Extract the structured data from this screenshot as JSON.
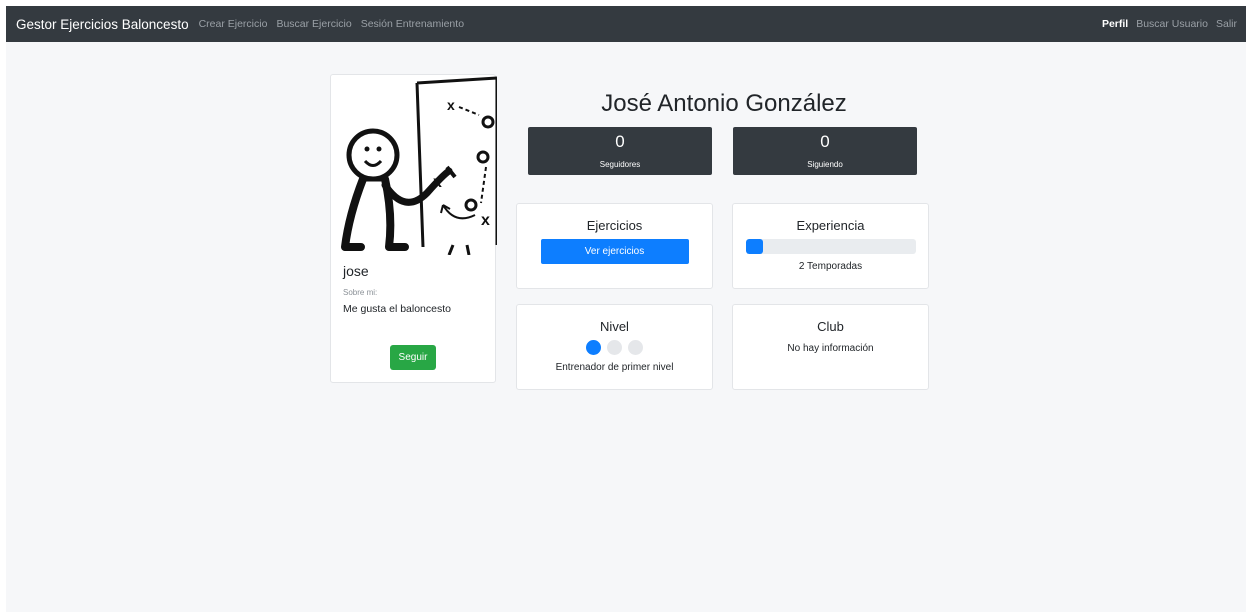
{
  "navbar": {
    "brand": "Gestor Ejercicios Baloncesto",
    "links": [
      "Crear Ejercicio",
      "Buscar Ejercicio",
      "Sesión Entrenamiento"
    ],
    "right_links": [
      "Perfil",
      "Buscar Usuario",
      "Salir"
    ],
    "active_link": "Perfil"
  },
  "profile": {
    "username": "jose",
    "about_label": "Sobre mi:",
    "about_text": "Me gusta el baloncesto",
    "follow_label": "Seguir",
    "full_name": "José Antonio González"
  },
  "stats": {
    "followers_count": "0",
    "followers_label": "Seguidores",
    "following_count": "0",
    "following_label": "Siguiendo"
  },
  "exercises": {
    "title": "Ejercicios",
    "button_label": "Ver ejercicios"
  },
  "experience": {
    "title": "Experiencia",
    "progress_percent": 10,
    "text": "2 Temporadas"
  },
  "level": {
    "title": "Nivel",
    "dots_total": 3,
    "dots_filled": 1,
    "text": "Entrenador de primer nivel"
  },
  "club": {
    "title": "Club",
    "text": "No hay información"
  },
  "colors": {
    "navbar": "#343a40",
    "primary": "#0d7eff",
    "success": "#28a745",
    "background": "#f6f7f9"
  }
}
